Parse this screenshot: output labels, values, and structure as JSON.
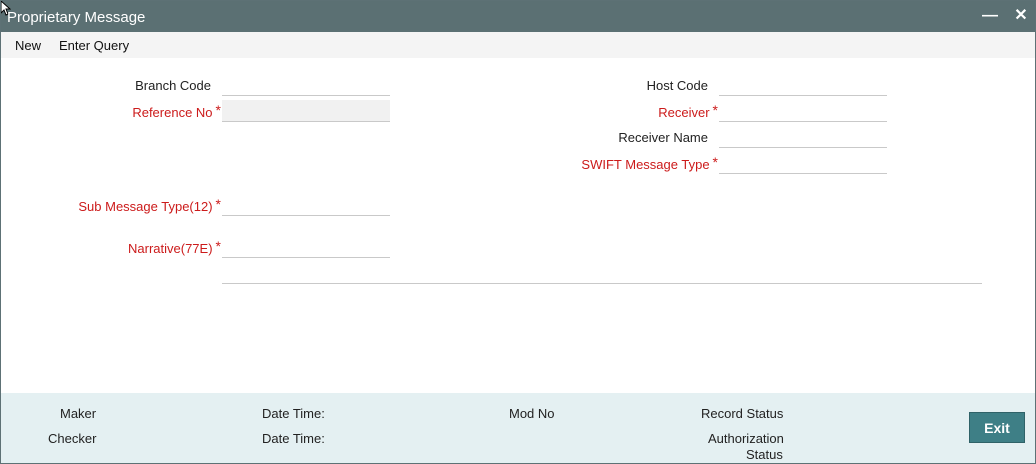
{
  "window": {
    "title": "Proprietary Message",
    "minimize_label": "—",
    "close_label": "✕"
  },
  "menu": {
    "new_label": "New",
    "enter_query_label": "Enter Query"
  },
  "form": {
    "branch_code": {
      "label": "Branch Code",
      "value": ""
    },
    "reference_no": {
      "label": "Reference No",
      "value": "",
      "required": "*"
    },
    "host_code": {
      "label": "Host Code",
      "value": ""
    },
    "receiver": {
      "label": "Receiver",
      "value": "",
      "required": "*"
    },
    "receiver_name": {
      "label": "Receiver Name",
      "value": ""
    },
    "swift_message_type": {
      "label": "SWIFT Message Type",
      "value": "",
      "required": "*"
    },
    "sub_message_type": {
      "label": "Sub Message Type(12)",
      "value": "",
      "required": "*"
    },
    "narrative": {
      "label": "Narrative(77E)",
      "value": "",
      "required": "*"
    }
  },
  "footer": {
    "maker_label": "Maker",
    "checker_label": "Checker",
    "maker_datetime_label": "Date Time:",
    "checker_datetime_label": "Date Time:",
    "mod_no_label": "Mod No",
    "record_status_label": "Record Status",
    "authorization_status_line1": "Authorization",
    "authorization_status_line2": "Status",
    "exit_label": "Exit"
  },
  "colors": {
    "titlebar": "#5b7073",
    "required": "#cc1b1b",
    "footer": "#e4f0f2",
    "exit_button": "#3e7f86"
  }
}
